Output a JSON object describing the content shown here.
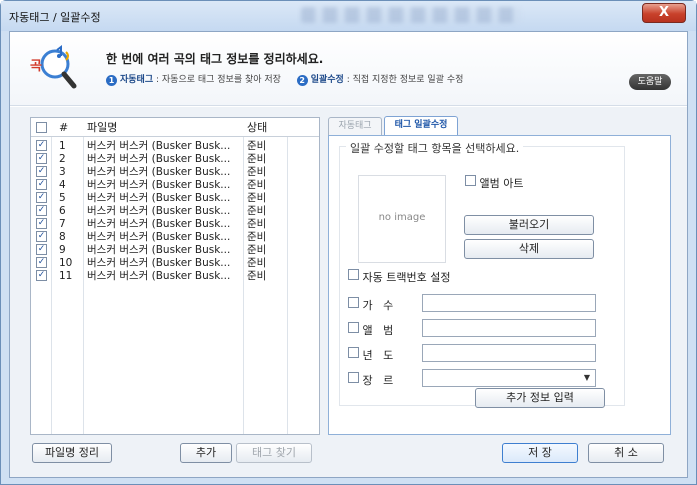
{
  "window": {
    "title": "자동태그 / 일괄수정",
    "close_label": "X"
  },
  "header": {
    "logo_text": "곡",
    "title": "한 번에 여러 곡의 태그 정보를 정리하세요.",
    "steps": [
      {
        "num": "1",
        "name": "자동태그",
        "desc": " : 자동으로 태그 정보를 찾아 저장"
      },
      {
        "num": "2",
        "name": "일괄수정",
        "desc": " : 직접 지정한 정보로 일괄 수정"
      }
    ],
    "help_label": "도움말"
  },
  "filelist": {
    "columns": {
      "num": "#",
      "name": "파일명",
      "status": "상태"
    },
    "rows": [
      {
        "num": "1",
        "name": "버스커 버스커 (Busker Busk...",
        "status": "준비"
      },
      {
        "num": "2",
        "name": "버스커 버스커 (Busker Busk...",
        "status": "준비"
      },
      {
        "num": "3",
        "name": "버스커 버스커 (Busker Busk...",
        "status": "준비"
      },
      {
        "num": "4",
        "name": "버스커 버스커 (Busker Busk...",
        "status": "준비"
      },
      {
        "num": "5",
        "name": "버스커 버스커 (Busker Busk...",
        "status": "준비"
      },
      {
        "num": "6",
        "name": "버스커 버스커 (Busker Busk...",
        "status": "준비"
      },
      {
        "num": "7",
        "name": "버스커 버스커 (Busker Busk...",
        "status": "준비"
      },
      {
        "num": "8",
        "name": "버스커 버스커 (Busker Busk...",
        "status": "준비"
      },
      {
        "num": "9",
        "name": "버스커 버스커 (Busker Busk...",
        "status": "준비"
      },
      {
        "num": "10",
        "name": "버스커 버스커 (Busker Busk...",
        "status": "준비"
      },
      {
        "num": "11",
        "name": "버스커 버스커 (Busker Busk...",
        "status": "준비"
      }
    ]
  },
  "tabs": {
    "auto": "자동태그",
    "batch": "태그 일괄수정"
  },
  "batch": {
    "group_title": "일괄 수정할 태그 항목을 선택하세요.",
    "no_image": "no image",
    "album_art": "앨범 아트",
    "load": "불러오기",
    "delete": "삭제",
    "auto_track": "자동 트랙번호 설정",
    "artist": "가   수",
    "album": "앨   범",
    "year": "년   도",
    "genre": "장   르",
    "extra": "추가 정보 입력"
  },
  "footer": {
    "organize": "파일명 정리",
    "add": "추가",
    "find_tag": "태그 찾기",
    "save": "저 장",
    "cancel": "취 소"
  }
}
